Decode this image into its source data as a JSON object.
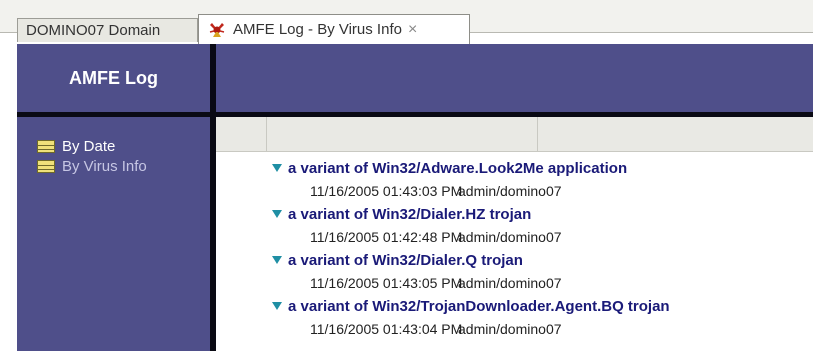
{
  "tabs": [
    {
      "label": "DOMINO07 Domain",
      "active": false
    },
    {
      "label": "AMFE Log - By Virus Info",
      "active": true,
      "icon": "amfe-app-icon",
      "close": "×"
    }
  ],
  "navigator": {
    "title": "AMFE Log",
    "items": [
      {
        "label": "By Date",
        "icon": "view-icon",
        "selected": true
      },
      {
        "label": "By Virus Info",
        "icon": "view-icon",
        "selected": false
      }
    ]
  },
  "view": {
    "groups": [
      {
        "category": "a variant of Win32/Adware.Look2Me application",
        "docs": [
          {
            "datetime": "11/16/2005 01:43:03 PM",
            "user": "admin/domino07"
          }
        ]
      },
      {
        "category": "a variant of Win32/Dialer.HZ trojan",
        "docs": [
          {
            "datetime": "11/16/2005 01:42:48 PM",
            "user": "admin/domino07"
          }
        ]
      },
      {
        "category": "a variant of Win32/Dialer.Q trojan",
        "docs": [
          {
            "datetime": "11/16/2005 01:43:05 PM",
            "user": "admin/domino07"
          }
        ]
      },
      {
        "category": "a variant of Win32/TrojanDownloader.Agent.BQ trojan",
        "docs": [
          {
            "datetime": "11/16/2005 01:43:04 PM",
            "user": "admin/domino07"
          }
        ]
      }
    ]
  },
  "colors": {
    "nav_bg": "#4f4f8a",
    "divider": "#0a0a14",
    "category_text": "#1a1a78",
    "twistie": "#1f8fa4"
  }
}
